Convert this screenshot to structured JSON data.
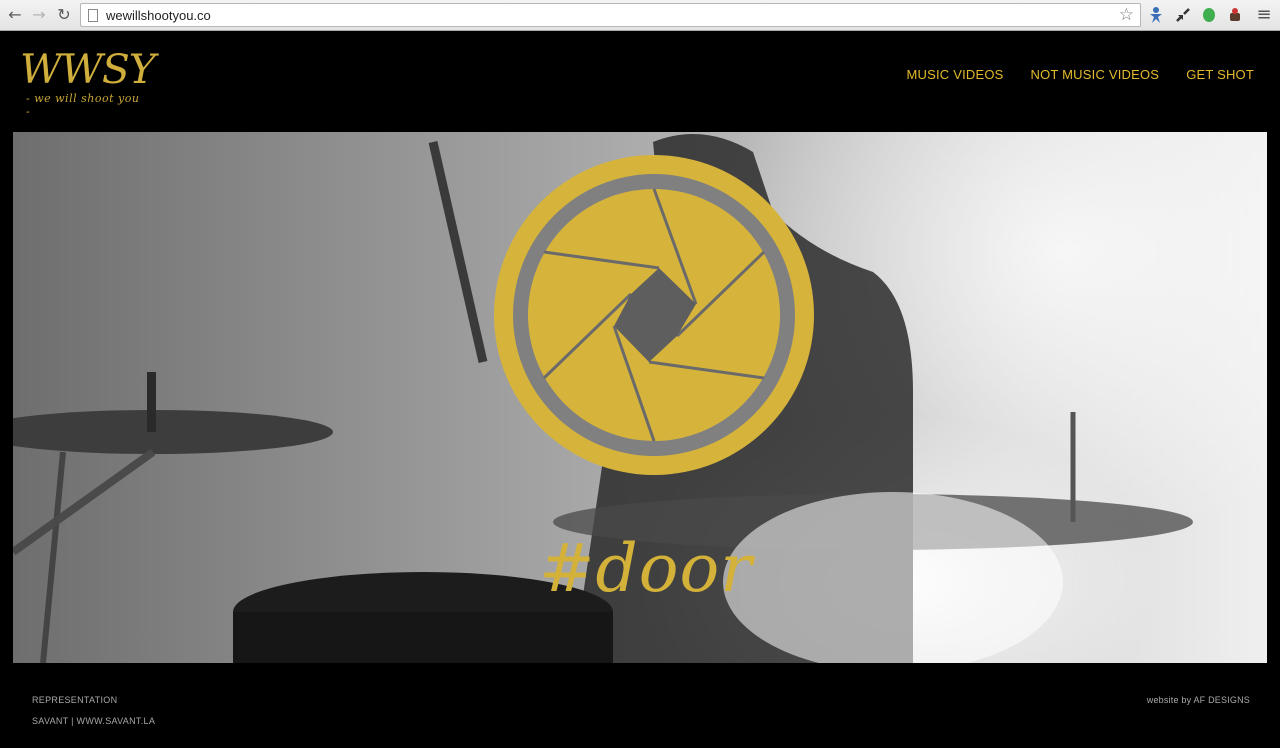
{
  "browser": {
    "url": "wewillshootyou.co",
    "back_glyph": "←",
    "forward_glyph": "→",
    "reload_glyph": "↻",
    "star_glyph": "☆",
    "menu_glyph": "≡"
  },
  "site": {
    "logo_text": "WWSY",
    "logo_tagline": "- we will shoot you -",
    "nav": [
      "MUSIC VIDEOS",
      "NOT MUSIC VIDEOS",
      "GET SHOT"
    ],
    "hero_hashtag": "#door",
    "accent_color": "#e3bb2c",
    "gold_color": "#d4b23a"
  },
  "footer": {
    "representation_label": "REPRESENTATION",
    "representation_value": "SAVANT | WWW.SAVANT.LA",
    "credit": "website by AF DESIGNS"
  }
}
